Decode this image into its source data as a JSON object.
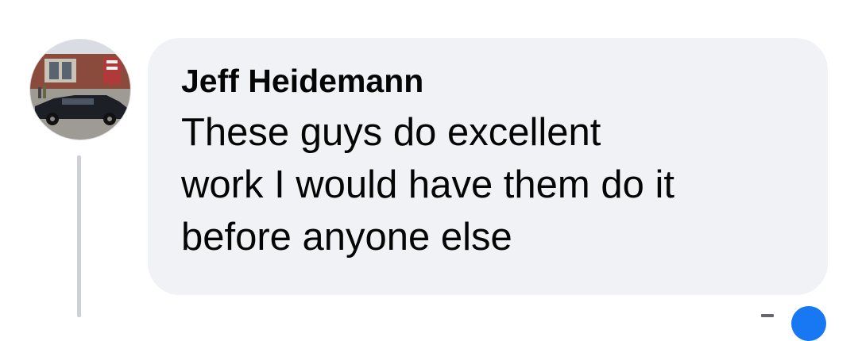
{
  "comment": {
    "author": "Jeff Heidemann",
    "text": "These guys do excellent\nwork I would have them do it\nbefore anyone else"
  },
  "avatar": {
    "icon": "profile-photo-limousine",
    "colors": {
      "sky": "#d9dde3",
      "building": "#8a4b3c",
      "car": "#1c1f26",
      "ground": "#9e9a94"
    }
  },
  "theme": {
    "bubble": "#f0f2f5",
    "text": "#050505",
    "thread_line": "#ced0d4",
    "like_blue": "#1877f2"
  }
}
